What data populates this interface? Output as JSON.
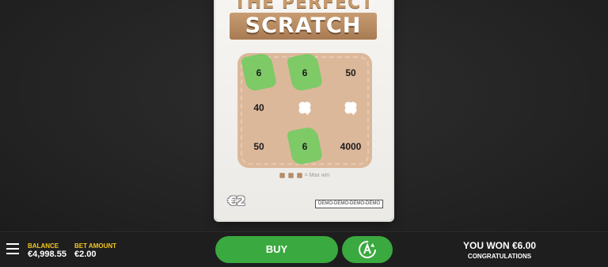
{
  "ticket": {
    "title_top": "THE PERFECT",
    "title_main": "SCRATCH",
    "cells": [
      "6",
      "6",
      "50",
      "40",
      "",
      "",
      "50",
      "6",
      "4000"
    ],
    "max_win_label": "= Max win",
    "price": "€2",
    "demo_tag": "DEMO-DEMO-DEMO-DEMO"
  },
  "bar": {
    "balance_label": "BALANCE",
    "balance_value": "€4,998.55",
    "bet_label": "BET AMOUNT",
    "bet_value": "€2.00",
    "buy_label": "BUY",
    "won_text": "YOU WON €6.00",
    "congrats_text": "CONGRATULATIONS"
  },
  "colors": {
    "accent_green": "#3aa93f",
    "label_yellow": "#f3c623",
    "scratch_tan": "#dcb89a"
  },
  "icons": {
    "menu": "hamburger-menu-icon",
    "autoplay": "autoplay-icon",
    "clover": "clover-icon"
  }
}
